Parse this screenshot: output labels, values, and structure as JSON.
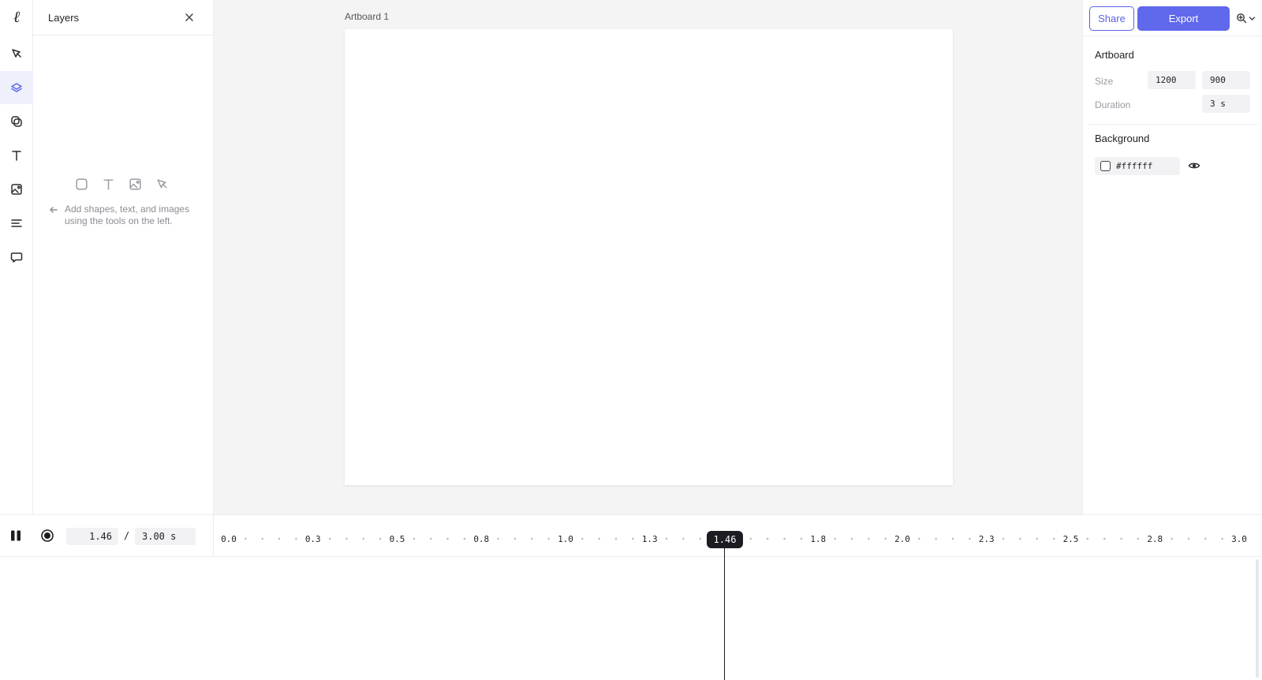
{
  "rail": {
    "logo": "ℓ",
    "tools": [
      {
        "name": "pen-tool",
        "active": false
      },
      {
        "name": "layers-tool",
        "active": true
      },
      {
        "name": "shapes-tool",
        "active": false
      },
      {
        "name": "text-tool",
        "active": false
      },
      {
        "name": "image-tool",
        "active": false
      },
      {
        "name": "align-tool",
        "active": false
      },
      {
        "name": "comment-tool",
        "active": false
      }
    ]
  },
  "layers": {
    "title": "Layers",
    "empty_hint": "Add shapes, text, and images using the tools on the left."
  },
  "canvas": {
    "artboard_label": "Artboard 1"
  },
  "inspector": {
    "share_label": "Share",
    "export_label": "Export",
    "artboard_title": "Artboard",
    "size_label": "Size",
    "width": "1200",
    "height": "900",
    "duration_label": "Duration",
    "duration": "3 s",
    "background_title": "Background",
    "bg_color": "#ffffff"
  },
  "timeline": {
    "current_time": "1.46",
    "total_time": "3.00 s",
    "separator": "/",
    "ticks": [
      "0.0",
      "0.3",
      "0.5",
      "0.8",
      "1.0",
      "1.3",
      "1.5",
      "1.8",
      "2.0",
      "2.3",
      "2.5",
      "2.8",
      "3.0"
    ],
    "playhead_label": "1.46",
    "playhead_value": 1.46,
    "duration_value": 3.0
  },
  "colors": {
    "accent": "#6068ec",
    "playhead": "#1c1c22"
  }
}
